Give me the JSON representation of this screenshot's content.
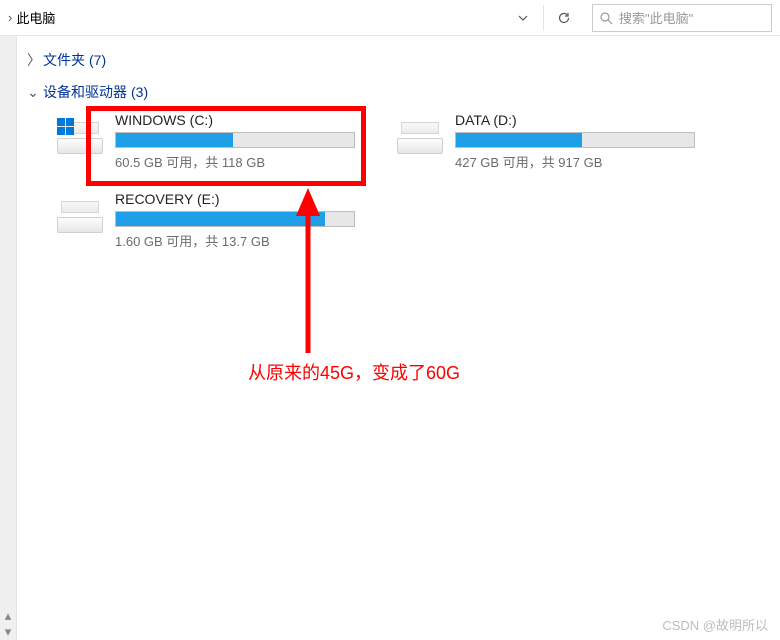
{
  "topbar": {
    "location": "此电脑",
    "search_placeholder": "搜索\"此电脑\""
  },
  "sections": {
    "folders": {
      "label": "文件夹",
      "count": "(7)"
    },
    "devices": {
      "label": "设备和驱动器",
      "count": "(3)"
    }
  },
  "drives": [
    {
      "name": "WINDOWS (C:)",
      "stats": "60.5 GB 可用，共 118 GB",
      "fill_pct": 49,
      "icon": "windows"
    },
    {
      "name": "DATA (D:)",
      "stats": "427 GB 可用，共 917 GB",
      "fill_pct": 53,
      "icon": "drive"
    },
    {
      "name": "RECOVERY (E:)",
      "stats": "1.60 GB 可用，共 13.7 GB",
      "fill_pct": 88,
      "icon": "drive"
    }
  ],
  "annotation": {
    "text": "从原来的45G，变成了60G"
  },
  "watermark": "CSDN @故明所以"
}
